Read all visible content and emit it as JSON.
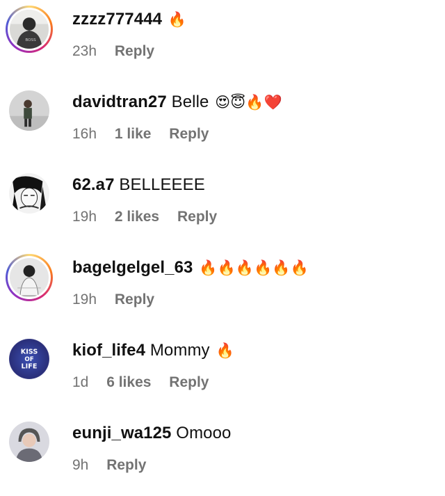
{
  "comments": [
    {
      "username": "zzzz777444",
      "text": "",
      "emoji": "🔥",
      "time": "23h",
      "likes": "",
      "reply": "Reply",
      "avatar": "photo-person-boss-sweater",
      "ring": true
    },
    {
      "username": "davidtran27",
      "text": "Belle",
      "emoji": "😍😇🔥❤️",
      "time": "16h",
      "likes": "1 like",
      "reply": "Reply",
      "avatar": "photo-person-gray-room",
      "ring": false
    },
    {
      "username": "62.a7",
      "text": "BELLEEEE",
      "emoji": "",
      "time": "19h",
      "likes": "2 likes",
      "reply": "Reply",
      "avatar": "anime-drawing",
      "ring": false
    },
    {
      "username": "bagelgelgel_63",
      "text": "",
      "emoji": "🔥🔥🔥🔥🔥🔥",
      "time": "19h",
      "likes": "",
      "reply": "Reply",
      "avatar": "sketch-person",
      "ring": true
    },
    {
      "username": "kiof_life4",
      "text": "Mommy",
      "emoji": "🔥",
      "time": "1d",
      "likes": "6 likes",
      "reply": "Reply",
      "avatar": "kiss-of-life-logo",
      "logo_text": [
        "KISS",
        "OF",
        "LIFE"
      ],
      "ring": false
    },
    {
      "username": "eunji_wa125",
      "text": "Omooo",
      "emoji": "",
      "time": "9h",
      "likes": "",
      "reply": "Reply",
      "avatar": "photo-person-hood",
      "ring": false
    }
  ]
}
